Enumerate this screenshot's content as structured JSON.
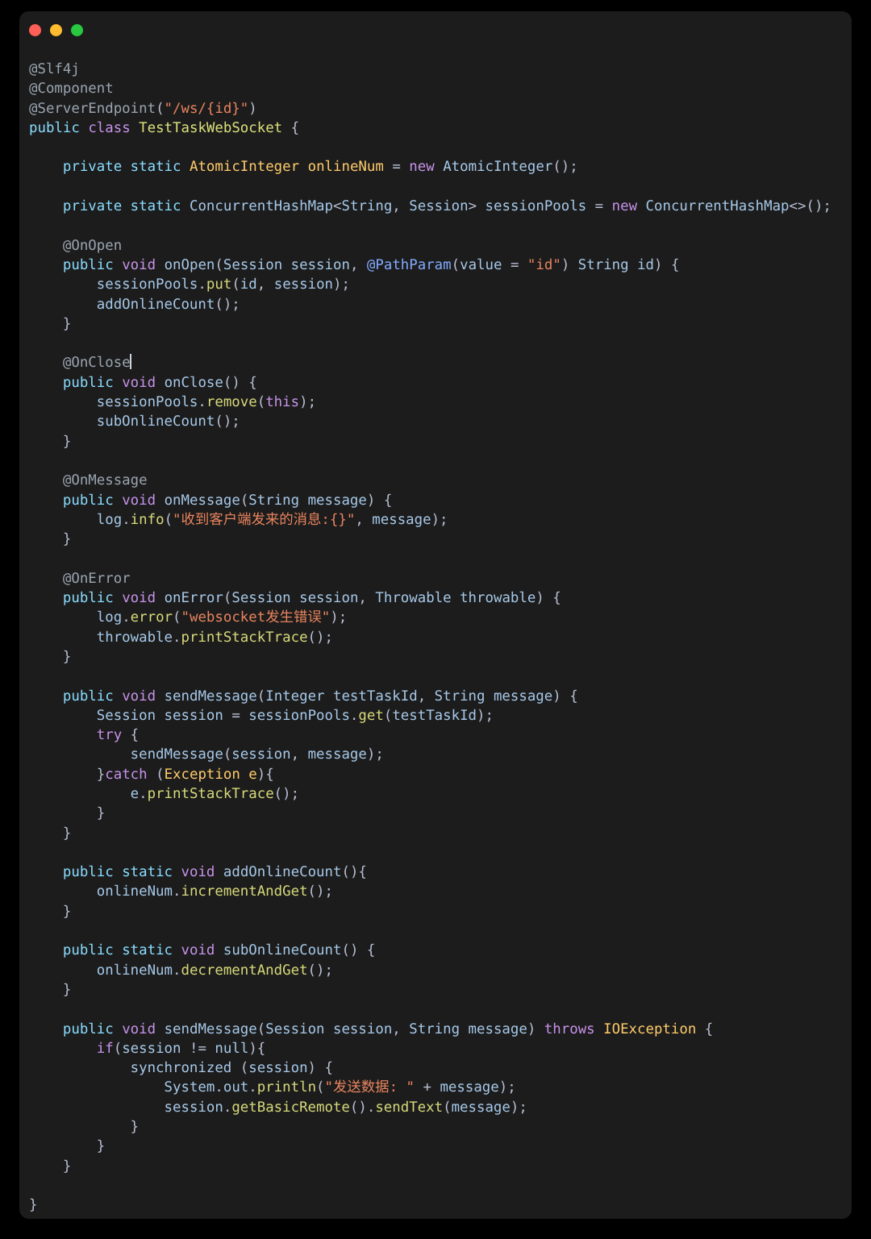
{
  "window": {
    "title": "",
    "controls": [
      {
        "name": "close",
        "color": "#ff5f57"
      },
      {
        "name": "minimize",
        "color": "#febc2e"
      },
      {
        "name": "maximize",
        "color": "#28c840"
      }
    ]
  },
  "editor": {
    "language": "java",
    "theme_background": "#1c1c1c",
    "page_background": "#000000",
    "default_text_color": "#a6accd",
    "caret_after_text": "@OnClose",
    "colors": {
      "keyword": "#c792ea",
      "modifier": "#89ddff",
      "type": "#ffcb6b",
      "annotation": "#9aa5b1",
      "string": "#e8845f",
      "function": "#d7d97a",
      "identifier": "#a6c8e8",
      "class_name": "#dbe07a"
    },
    "lines": [
      "@Slf4j",
      "@Component",
      "@ServerEndpoint(\"/ws/{id}\")",
      "public class TestTaskWebSocket {",
      "",
      "    private static AtomicInteger onlineNum = new AtomicInteger();",
      "",
      "    private static ConcurrentHashMap<String, Session> sessionPools = new ConcurrentHashMap<>();",
      "",
      "    @OnOpen",
      "    public void onOpen(Session session, @PathParam(value = \"id\") String id) {",
      "        sessionPools.put(id, session);",
      "        addOnlineCount();",
      "    }",
      "",
      "    @OnClose",
      "    public void onClose() {",
      "        sessionPools.remove(this);",
      "        subOnlineCount();",
      "    }",
      "",
      "    @OnMessage",
      "    public void onMessage(String message) {",
      "        log.info(\"收到客户端发来的消息:{}\", message);",
      "    }",
      "",
      "    @OnError",
      "    public void onError(Session session, Throwable throwable) {",
      "        log.error(\"websocket发生错误\");",
      "        throwable.printStackTrace();",
      "    }",
      "",
      "    public void sendMessage(Integer testTaskId, String message) {",
      "        Session session = sessionPools.get(testTaskId);",
      "        try {",
      "            sendMessage(session, message);",
      "        }catch (Exception e){",
      "            e.printStackTrace();",
      "        }",
      "    }",
      "",
      "    public static void addOnlineCount(){",
      "        onlineNum.incrementAndGet();",
      "    }",
      "",
      "    public static void subOnlineCount() {",
      "        onlineNum.decrementAndGet();",
      "    }",
      "",
      "    public void sendMessage(Session session, String message) throws IOException {",
      "        if(session != null){",
      "            synchronized (session) {",
      "                System.out.println(\"发送数据: \" + message);",
      "                session.getBasicRemote().sendText(message);",
      "            }",
      "        }",
      "    }",
      "",
      "}"
    ],
    "strings": [
      "\"/ws/{id}\"",
      "\"id\"",
      "\"收到客户端发来的消息:{}\"",
      "\"websocket发生错误\"",
      "\"发送数据: \""
    ],
    "annotations": [
      "@Slf4j",
      "@Component",
      "@ServerEndpoint",
      "@OnOpen",
      "@OnClose",
      "@OnMessage",
      "@OnError",
      "@PathParam"
    ],
    "class_name": "TestTaskWebSocket",
    "methods": [
      "onOpen",
      "onClose",
      "onMessage",
      "onError",
      "sendMessage",
      "addOnlineCount",
      "subOnlineCount"
    ],
    "fields": [
      "onlineNum",
      "sessionPools"
    ]
  }
}
